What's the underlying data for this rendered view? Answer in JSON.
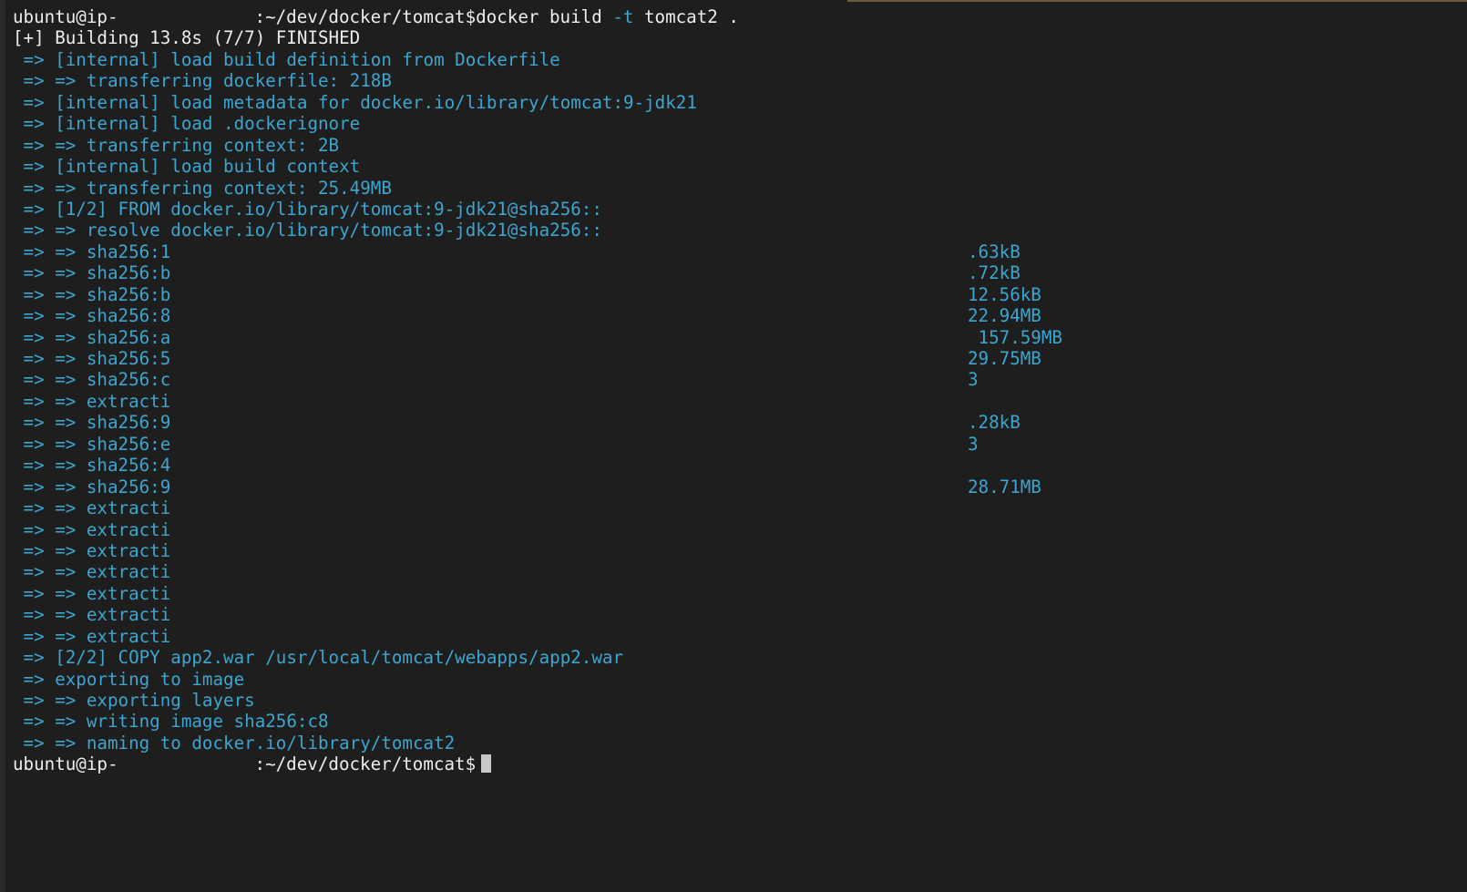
{
  "terminal": {
    "prompt_user": "ubuntu@ip-",
    "prompt_path": ":~/dev/docker/tomcat$",
    "command": "docker build ",
    "command_flag": "-t",
    "command_rest": " tomcat2 .",
    "build_status": "[+] Building 13.8s (7/7) FINISHED",
    "lines": [
      " => [internal] load build definition from Dockerfile",
      " => => transferring dockerfile: 218B",
      " => [internal] load metadata for docker.io/library/tomcat:9-jdk21",
      " => [internal] load .dockerignore",
      " => => transferring context: 2B",
      " => [internal] load build context",
      " => => transferring context: 25.49MB",
      " => [1/2] FROM docker.io/library/tomcat:9-jdk21@sha256::",
      " => => resolve docker.io/library/tomcat:9-jdk21@sha256::",
      " => => sha256:1",
      " => => sha256:b",
      " => => sha256:b",
      " => => sha256:8",
      " => => sha256:a",
      " => => sha256:5",
      " => => sha256:c",
      " => => extracti",
      " => => sha256:9",
      " => => sha256:e",
      " => => sha256:4",
      " => => sha256:9",
      " => => extracti",
      " => => extracti",
      " => => extracti",
      " => => extracti",
      " => => extracti",
      " => => extracti",
      " => => extracti",
      " => [2/2] COPY app2.war /usr/local/tomcat/webapps/app2.war",
      " => exporting to image",
      " => => exporting layers",
      " => => writing image sha256:c8",
      " => => naming to docker.io/library/tomcat2"
    ],
    "right_fragments": [
      "",
      "",
      "",
      "",
      "",
      "",
      "",
      "",
      "",
      ".63kB",
      ".72kB",
      "12.56kB",
      "22.94MB",
      " 157.59MB",
      "29.75MB",
      "3",
      "",
      ".28kB",
      "3",
      "",
      "28.71MB",
      "",
      "",
      "",
      "",
      "",
      "",
      "",
      "",
      "",
      "",
      "",
      ""
    ]
  }
}
